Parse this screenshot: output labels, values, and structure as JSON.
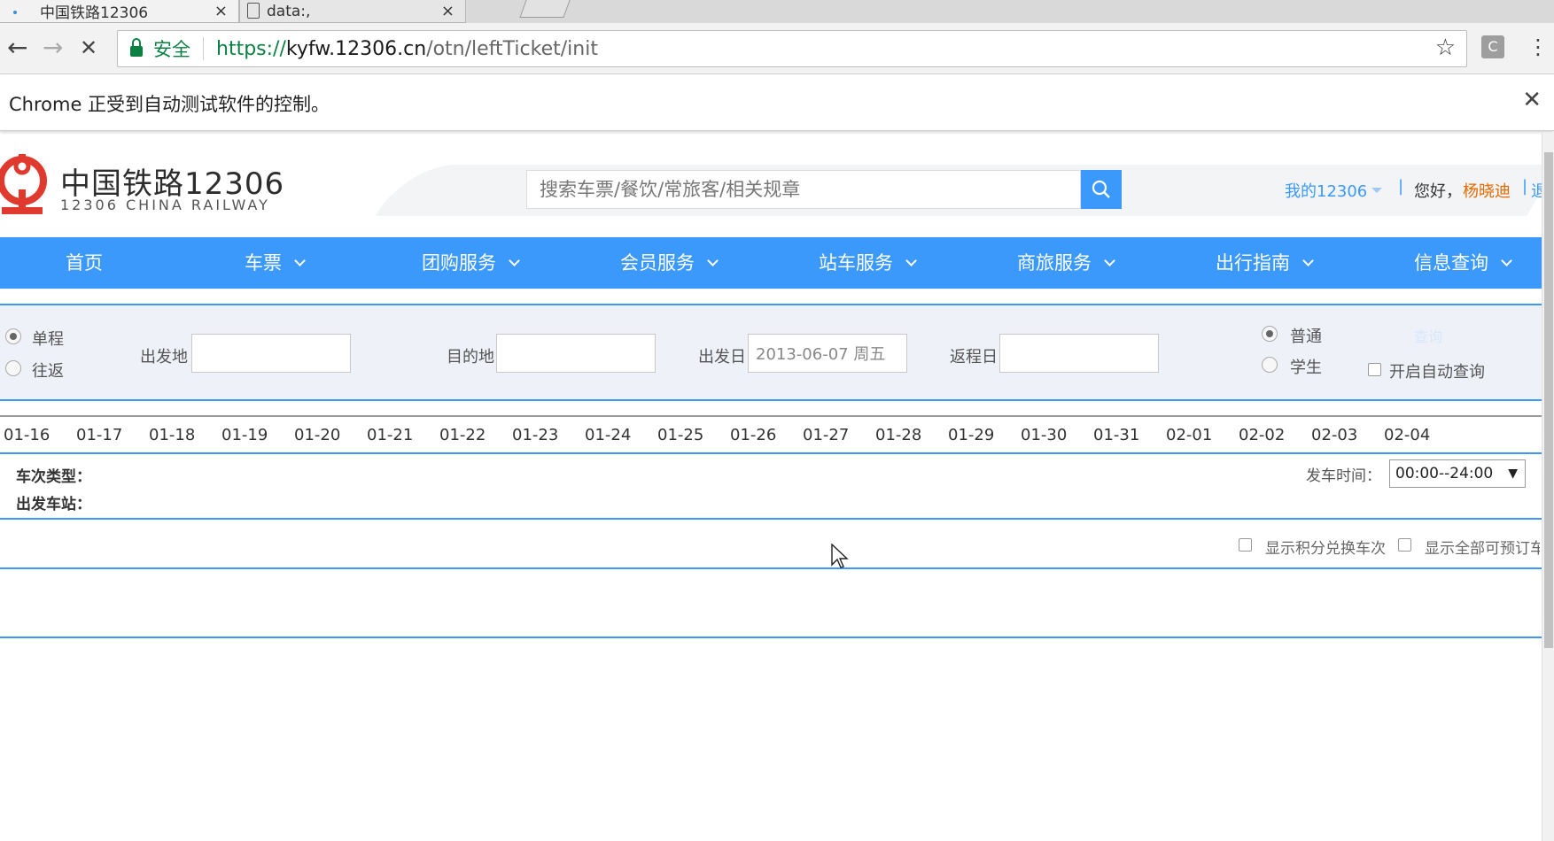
{
  "browser": {
    "tabs": [
      {
        "title": "中国铁路12306",
        "close": "×"
      },
      {
        "title": "data:,",
        "close": "×"
      }
    ],
    "back": "←",
    "forward": "→",
    "stop": "✕",
    "secure_label": "安全",
    "url_proto": "https://",
    "url_host": "kyfw.12306.cn",
    "url_path": "/otn/leftTicket/init",
    "star": "☆",
    "extension_letter": "C",
    "menu": "⋮",
    "infobar_text": "Chrome 正受到自动测试软件的控制。",
    "infobar_close": "✕"
  },
  "header": {
    "logo_cn": "中国铁路12306",
    "logo_en": "12306 CHINA RAILWAY",
    "search_placeholder": "搜索车票/餐饮/常旅客/相关规章",
    "my12306": "我的12306",
    "divider": "|",
    "greeting": "您好，",
    "username": "杨晓迪",
    "logout": "退出",
    "brand_color": "#3b99fc",
    "logo_color": "#e03a2f"
  },
  "nav": [
    {
      "label": "首页",
      "dropdown": false
    },
    {
      "label": "车票",
      "dropdown": true
    },
    {
      "label": "团购服务",
      "dropdown": true
    },
    {
      "label": "会员服务",
      "dropdown": true
    },
    {
      "label": "站车服务",
      "dropdown": true
    },
    {
      "label": "商旅服务",
      "dropdown": true
    },
    {
      "label": "出行指南",
      "dropdown": true
    },
    {
      "label": "信息查询",
      "dropdown": true
    }
  ],
  "query": {
    "trip_oneway": "单程",
    "trip_return": "往返",
    "from_label": "出发地",
    "to_label": "目的地",
    "depart_label": "出发日",
    "depart_value": "2013-06-07 周五",
    "return_label": "返程日",
    "type_normal": "普通",
    "type_student": "学生",
    "query_button": "查询",
    "auto_query": "开启自动查询"
  },
  "dates": [
    "01-16",
    "01-17",
    "01-18",
    "01-19",
    "01-20",
    "01-21",
    "01-22",
    "01-23",
    "01-24",
    "01-25",
    "01-26",
    "01-27",
    "01-28",
    "01-29",
    "01-30",
    "01-31",
    "02-01",
    "02-02",
    "02-03",
    "02-04"
  ],
  "filters": {
    "train_type_label": "车次类型：",
    "station_label": "出发车站：",
    "time_label": "发车时间：",
    "time_value": "00:00--24:00",
    "show_points": "显示积分兑换车次",
    "show_all": "显示全部可预订车次"
  }
}
